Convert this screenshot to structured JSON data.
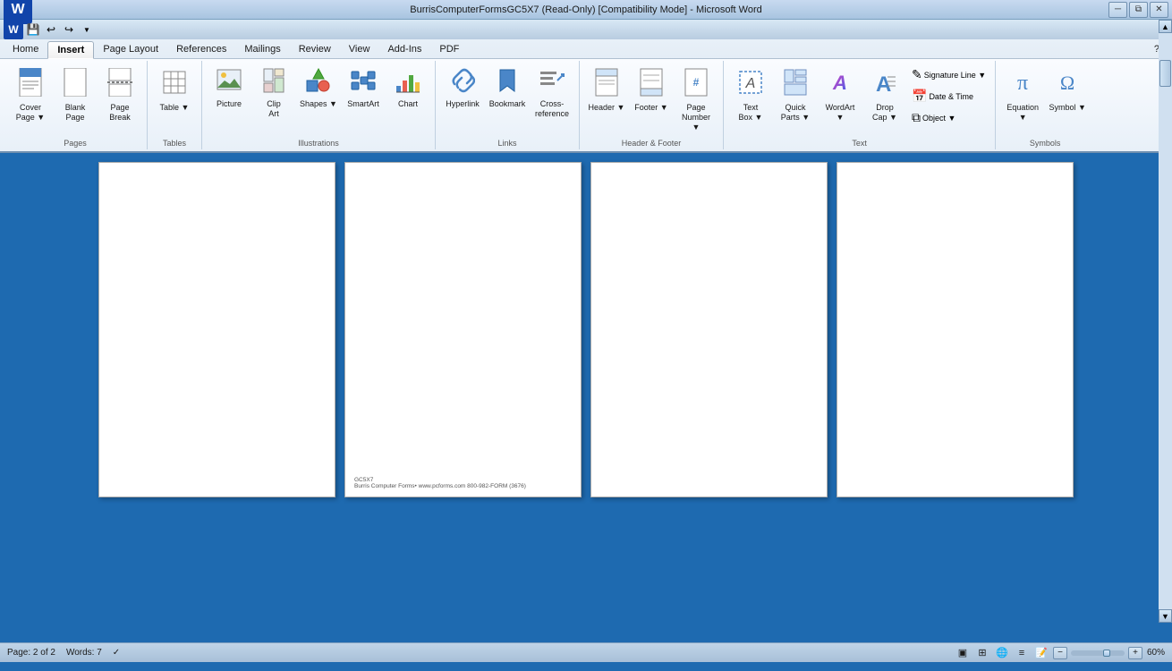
{
  "titleBar": {
    "title": "BurrisComputerFormsGC5X7 (Read-Only) [Compatibility Mode] - Microsoft Word",
    "controls": [
      "minimize",
      "restore",
      "close"
    ]
  },
  "quickAccess": {
    "buttons": [
      "save",
      "undo",
      "redo",
      "customize"
    ]
  },
  "ribbon": {
    "tabs": [
      "Home",
      "Insert",
      "Page Layout",
      "References",
      "Mailings",
      "Review",
      "View",
      "Add-Ins",
      "PDF"
    ],
    "activeTab": "Insert",
    "groups": [
      {
        "name": "Pages",
        "items": [
          {
            "id": "cover-page",
            "label": "Cover\nPage",
            "icon": "📄",
            "hasArrow": true
          },
          {
            "id": "blank-page",
            "label": "Blank\nPage",
            "icon": "📃"
          },
          {
            "id": "page-break",
            "label": "Page\nBreak",
            "icon": "📑"
          }
        ]
      },
      {
        "name": "Tables",
        "items": [
          {
            "id": "table",
            "label": "Table",
            "icon": "⊞",
            "hasArrow": true
          }
        ]
      },
      {
        "name": "Illustrations",
        "items": [
          {
            "id": "picture",
            "label": "Picture",
            "icon": "🖼"
          },
          {
            "id": "clip-art",
            "label": "Clip\nArt",
            "icon": "✂"
          },
          {
            "id": "shapes",
            "label": "Shapes",
            "icon": "⬡",
            "hasArrow": true
          },
          {
            "id": "smartart",
            "label": "SmartArt",
            "icon": "🔷"
          },
          {
            "id": "chart",
            "label": "Chart",
            "icon": "📊"
          }
        ]
      },
      {
        "name": "Links",
        "items": [
          {
            "id": "hyperlink",
            "label": "Hyperlink",
            "icon": "🔗"
          },
          {
            "id": "bookmark",
            "label": "Bookmark",
            "icon": "🔖"
          },
          {
            "id": "cross-reference",
            "label": "Cross-reference",
            "icon": "↗"
          }
        ]
      },
      {
        "name": "Header & Footer",
        "items": [
          {
            "id": "header",
            "label": "Header",
            "icon": "▭",
            "hasArrow": true
          },
          {
            "id": "footer",
            "label": "Footer",
            "icon": "▬",
            "hasArrow": true
          },
          {
            "id": "page-number",
            "label": "Page\nNumber",
            "icon": "#",
            "hasArrow": true
          }
        ]
      },
      {
        "name": "Text",
        "items": [
          {
            "id": "text-box",
            "label": "Text\nBox",
            "icon": "T",
            "hasArrow": true
          },
          {
            "id": "quick-parts",
            "label": "Quick\nParts",
            "icon": "⊡",
            "hasArrow": true
          },
          {
            "id": "wordart",
            "label": "WordArt",
            "icon": "A",
            "hasArrow": true
          },
          {
            "id": "drop-cap",
            "label": "Drop\nCap",
            "icon": "A",
            "hasArrow": true
          },
          {
            "id": "signature-line",
            "label": "Signature Line",
            "icon": "✎",
            "hasArrow": true
          },
          {
            "id": "date-time",
            "label": "Date & Time",
            "icon": "📅"
          },
          {
            "id": "object",
            "label": "Object",
            "icon": "⧉",
            "hasArrow": true
          }
        ]
      },
      {
        "name": "Symbols",
        "items": [
          {
            "id": "equation",
            "label": "Equation",
            "icon": "π",
            "hasArrow": true
          },
          {
            "id": "symbol",
            "label": "Symbol",
            "icon": "Ω",
            "hasArrow": true
          }
        ]
      }
    ]
  },
  "pages": [
    {
      "id": "page1",
      "hasFooter": false,
      "footerText": ""
    },
    {
      "id": "page2",
      "hasFooter": true,
      "footerLine1": "GC5X7",
      "footerLine2": "Burris Computer Forms• www.pcforms.com 800-982-FORM (3676)"
    },
    {
      "id": "page3",
      "hasFooter": false,
      "footerText": ""
    },
    {
      "id": "page4",
      "hasFooter": false,
      "footerText": ""
    }
  ],
  "statusBar": {
    "pageInfo": "Page: 2 of 2",
    "wordCount": "Words: 7",
    "zoom": "60%"
  }
}
